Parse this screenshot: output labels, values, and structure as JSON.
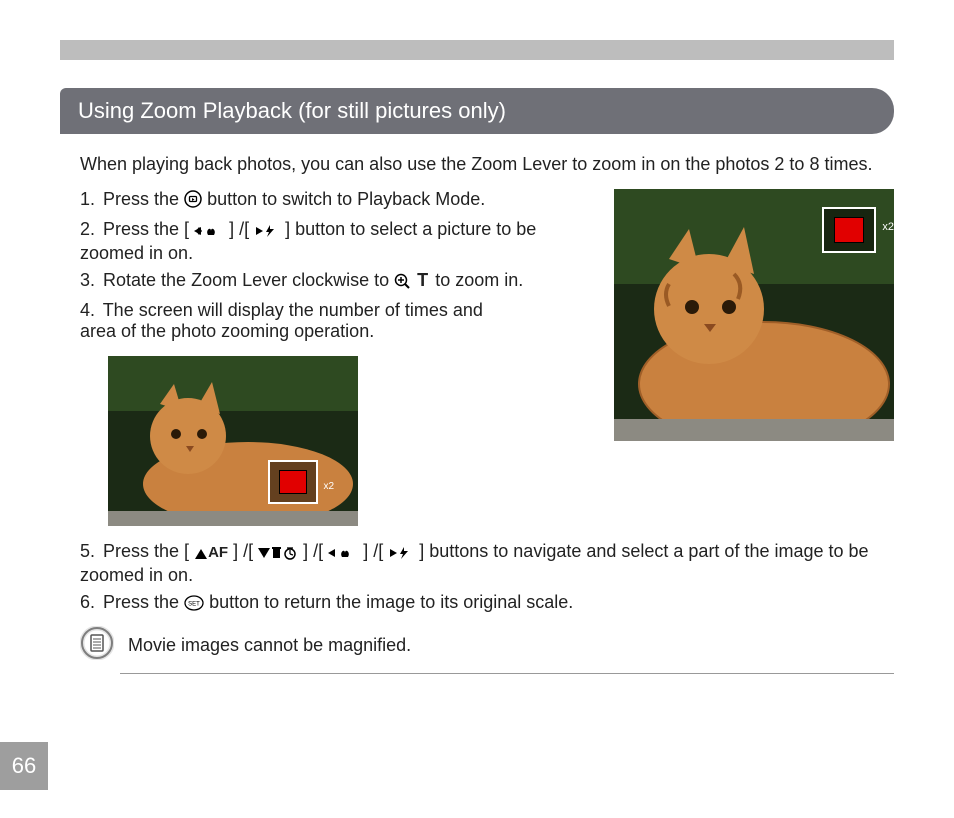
{
  "section_title": "Using Zoom Playback (for still pictures only)",
  "intro": "When playing back photos, you can also use the Zoom Lever to zoom in on the photos 2 to 8 times.",
  "steps": {
    "s1a": "Press the ",
    "s1b": " button to switch to Playback Mode.",
    "s2a": "Press the [",
    "s2b": "] /[",
    "s2c": "] button to select a picture to be zoomed in on.",
    "s3a": "Rotate the Zoom Lever clockwise to ",
    "s3b": " to zoom in.",
    "s4": "The screen will display the number of times and area of the photo zooming operation.",
    "s5a": "Press the [",
    "s5b": "] /[",
    "s5c": "] /[",
    "s5d": "] /[",
    "s5e": "] buttons to navigate and select a part of the image to be zoomed in on.",
    "s6a": "Press the ",
    "s6b": " button to return the image to its original scale."
  },
  "note": "Movie images cannot be magnified.",
  "page_number": "66",
  "zoom_labels": {
    "small": "x2",
    "big": "x2"
  },
  "labels": {
    "af": "AF",
    "set": "SET",
    "t": "T"
  }
}
